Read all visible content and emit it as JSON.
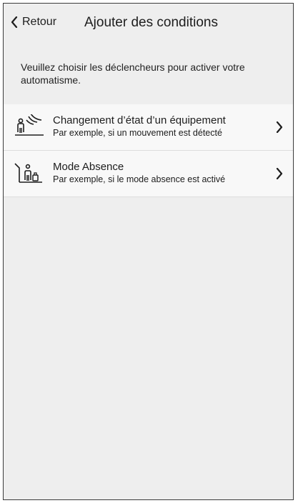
{
  "header": {
    "back_label": "Retour",
    "title": "Ajouter des conditions",
    "back_icon": "chevron-left-icon"
  },
  "intro": {
    "text": "Veuillez choisir les déclencheurs pour activer votre automatisme."
  },
  "conditions": [
    {
      "title": "Changement d’état d’un équipement",
      "subtitle": "Par exemple, si un mouvement est détecté",
      "icon": "motion-sensor-icon"
    },
    {
      "title": "Mode Absence",
      "subtitle": "Par exemple, si le mode absence est activé",
      "icon": "away-mode-icon"
    }
  ],
  "colors": {
    "background": "#eeeeee",
    "row_background": "#f8f8f8",
    "text": "#1d1d1d",
    "divider": "#dddddd"
  }
}
